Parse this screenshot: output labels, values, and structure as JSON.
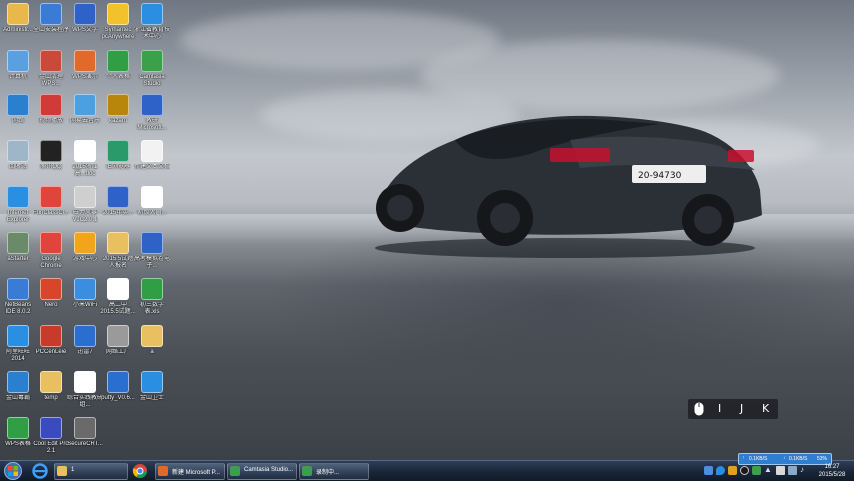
{
  "desktop_icons": [
    {
      "label": "Administr...",
      "icon": "user-folder-icon",
      "color": "#e8b84a"
    },
    {
      "label": "全山安装程序",
      "icon": "app-icon",
      "color": "#3a7bd5"
    },
    {
      "label": "WPS文字",
      "icon": "wps-writer-icon",
      "color": "#2f62c9"
    },
    {
      "label": "Symantec pcAnywhere",
      "icon": "symantec-icon",
      "color": "#f2c12e"
    },
    {
      "label": "浙江省教育技术中心",
      "icon": "ie-icon",
      "color": "#2a8fe0"
    },
    {
      "label": "计算机",
      "icon": "computer-icon",
      "color": "#5aa0e0"
    },
    {
      "label": "金山清理WPS...",
      "icon": "wps-icon",
      "color": "#c94a3a"
    },
    {
      "label": "WPS演示",
      "icon": "wps-presentation-icon",
      "color": "#e06a2a"
    },
    {
      "label": "个人表格",
      "icon": "excel-icon",
      "color": "#2f9e44"
    },
    {
      "label": "Camtasia Studio",
      "icon": "camtasia-icon",
      "color": "#3aa04a"
    },
    {
      "label": "网络",
      "icon": "network-icon",
      "color": "#2a7fcf"
    },
    {
      "label": "视频播放",
      "icon": "video-icon",
      "color": "#d23a3a"
    },
    {
      "label": "网易云音乐",
      "icon": "music-icon",
      "color": "#4aa0e0"
    },
    {
      "label": "kazam",
      "icon": "kazam-icon",
      "color": "#b8860b"
    },
    {
      "label": "教研 Microsoft...",
      "icon": "word-icon",
      "color": "#2f62c9"
    },
    {
      "label": "回收站",
      "icon": "recycle-bin-icon",
      "color": "#9fb6c8"
    },
    {
      "label": "腾讯QQ",
      "icon": "qq-icon",
      "color": "#222"
    },
    {
      "label": "2015浙江高...doc",
      "icon": "doc-icon",
      "color": "#ffffff"
    },
    {
      "label": "IE浏览器",
      "icon": "browser-icon",
      "color": "#2a9a6a"
    },
    {
      "label": "新建文本文档",
      "icon": "text-file-icon",
      "color": "#f2f2f2"
    },
    {
      "label": "Internet Explorer",
      "icon": "ie-icon",
      "color": "#2a8fe0"
    },
    {
      "label": "FunClassCl...",
      "icon": "chrome-icon",
      "color": "#e0443a"
    },
    {
      "label": "磁力风暴VJC2.0.1",
      "icon": "tool-icon",
      "color": "#cfcfcf"
    },
    {
      "label": "2015年实...",
      "icon": "word-icon",
      "color": "#2f62c9"
    },
    {
      "label": "初级入门...",
      "icon": "doc-icon",
      "color": "#ffffff"
    },
    {
      "label": "aStarter",
      "icon": "starter-icon",
      "color": "#6a8a6a"
    },
    {
      "label": "Google Chrome",
      "icon": "chrome-icon",
      "color": "#e0443a"
    },
    {
      "label": "游戏中心",
      "icon": "star-icon",
      "color": "#f2a51a"
    },
    {
      "label": "2015.5试题人报名",
      "icon": "folder-icon",
      "color": "#e8c060"
    },
    {
      "label": "高考模拟卷电子...",
      "icon": "word-icon",
      "color": "#2f62c9"
    },
    {
      "label": "NetBeans IDE 8.0.2",
      "icon": "netbeans-icon",
      "color": "#3a7bd5"
    },
    {
      "label": "Nero",
      "icon": "nero-icon",
      "color": "#d8452a"
    },
    {
      "label": "小米WiFi",
      "icon": "wifi-icon",
      "color": "#3a8ee0"
    },
    {
      "label": "高二中2015.5试题...",
      "icon": "doc-icon",
      "color": "#ffffff"
    },
    {
      "label": "初三数学表.xls",
      "icon": "excel-icon",
      "color": "#2f9e44"
    },
    {
      "label": "阿里旺旺2014",
      "icon": "aliwangwang-icon",
      "color": "#2a8fe0"
    },
    {
      "label": "PCCenLeie",
      "icon": "pc-icon",
      "color": "#c83a2a"
    },
    {
      "label": "迅雷7",
      "icon": "thunder-icon",
      "color": "#2a6fd0"
    },
    {
      "label": "网络工厂",
      "icon": "gear-icon",
      "color": "#9a9a9a"
    },
    {
      "label": "a",
      "icon": "folder-icon",
      "color": "#e8c060"
    },
    {
      "label": "金山毒霸",
      "icon": "shield-icon",
      "color": "#2a7fcf"
    },
    {
      "label": "temp",
      "icon": "folder-icon",
      "color": "#e8c060"
    },
    {
      "label": "综合实践教研组...",
      "icon": "doc-icon",
      "color": "#ffffff"
    },
    {
      "label": "putty_V0.6...",
      "icon": "putty-icon",
      "color": "#2a6fd0"
    },
    {
      "label": "金山卫士",
      "icon": "shield-icon",
      "color": "#2a8fe0"
    },
    {
      "label": "WPS表格",
      "icon": "wps-spreadsheet-icon",
      "color": "#2f9e44"
    },
    {
      "label": "Cool Edit Pro 2.1",
      "icon": "cool-edit-icon",
      "color": "#3a4abf"
    },
    {
      "label": "SecureCRT...",
      "icon": "terminal-icon",
      "color": "#6a6a6a"
    }
  ],
  "overlay": {
    "keys": [
      "I",
      "J",
      "K"
    ]
  },
  "taskbar": {
    "tasks": [
      {
        "label": "1",
        "color": "#e8c060"
      },
      {
        "label": "新建 Microsoft P...",
        "color": "#e06a2a"
      },
      {
        "label": "Camtasia Studio...",
        "color": "#3aa04a"
      },
      {
        "label": "录制中...",
        "color": "#3aa04a"
      }
    ],
    "net_up": "0.1KB/S",
    "net_down": "0.1KB/S",
    "net_pct": "53%",
    "time": "16:27",
    "date": "2015/5/28"
  }
}
